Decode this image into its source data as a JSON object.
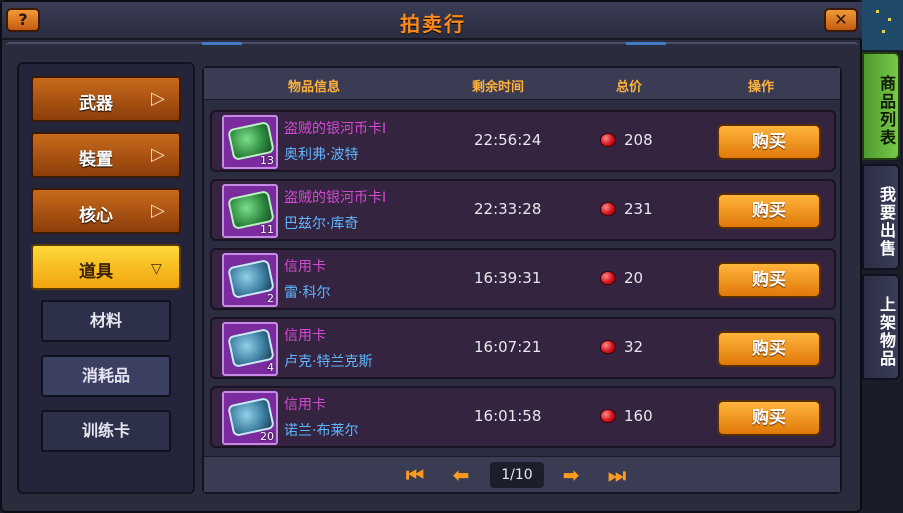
{
  "window": {
    "title": "拍卖行",
    "help_label": "?",
    "close_label": "✕"
  },
  "categories": [
    {
      "label": "武器",
      "chevron": "▷"
    },
    {
      "label": "裝置",
      "chevron": "▷"
    },
    {
      "label": "核心",
      "chevron": "▷"
    },
    {
      "label": "道具",
      "chevron": "▽"
    }
  ],
  "subcategories": [
    {
      "label": "材料"
    },
    {
      "label": "消耗品"
    },
    {
      "label": "训练卡"
    }
  ],
  "table": {
    "headers": {
      "item_info": "物品信息",
      "time_left": "剩余时间",
      "total_price": "总价",
      "action": "操作"
    },
    "rows": [
      {
        "name": "盗贼的银河币卡I",
        "seller": "奥利弗·波特",
        "qty": "13",
        "time": "22:56:24",
        "price": "208",
        "buy": "购买",
        "card_color": "green"
      },
      {
        "name": "盗贼的银河币卡I",
        "seller": "巴兹尔·库奇",
        "qty": "11",
        "time": "22:33:28",
        "price": "231",
        "buy": "购买",
        "card_color": "green"
      },
      {
        "name": "信用卡",
        "seller": "雷·科尔",
        "qty": "2",
        "time": "16:39:31",
        "price": "20",
        "buy": "购买",
        "card_color": "blue"
      },
      {
        "name": "信用卡",
        "seller": "卢克·特兰克斯",
        "qty": "4",
        "time": "16:07:21",
        "price": "32",
        "buy": "购买",
        "card_color": "blue"
      },
      {
        "name": "信用卡",
        "seller": "诺兰·布莱尔",
        "qty": "20",
        "time": "16:01:58",
        "price": "160",
        "buy": "购买",
        "card_color": "blue"
      }
    ]
  },
  "pager": {
    "page_display": "1/10",
    "first_icon": "⏮",
    "prev_icon": "⬅",
    "next_icon": "➡",
    "last_icon": "⏭"
  },
  "side_tabs": [
    {
      "label": "商品列表"
    },
    {
      "label": "我要出售"
    },
    {
      "label": "上架物品"
    }
  ],
  "colors": {
    "accent_orange": "#ff8a1c",
    "item_name_purple": "#d44ad4",
    "seller_blue": "#5fb6ff",
    "active_tab_green": "#6bbf3f"
  }
}
